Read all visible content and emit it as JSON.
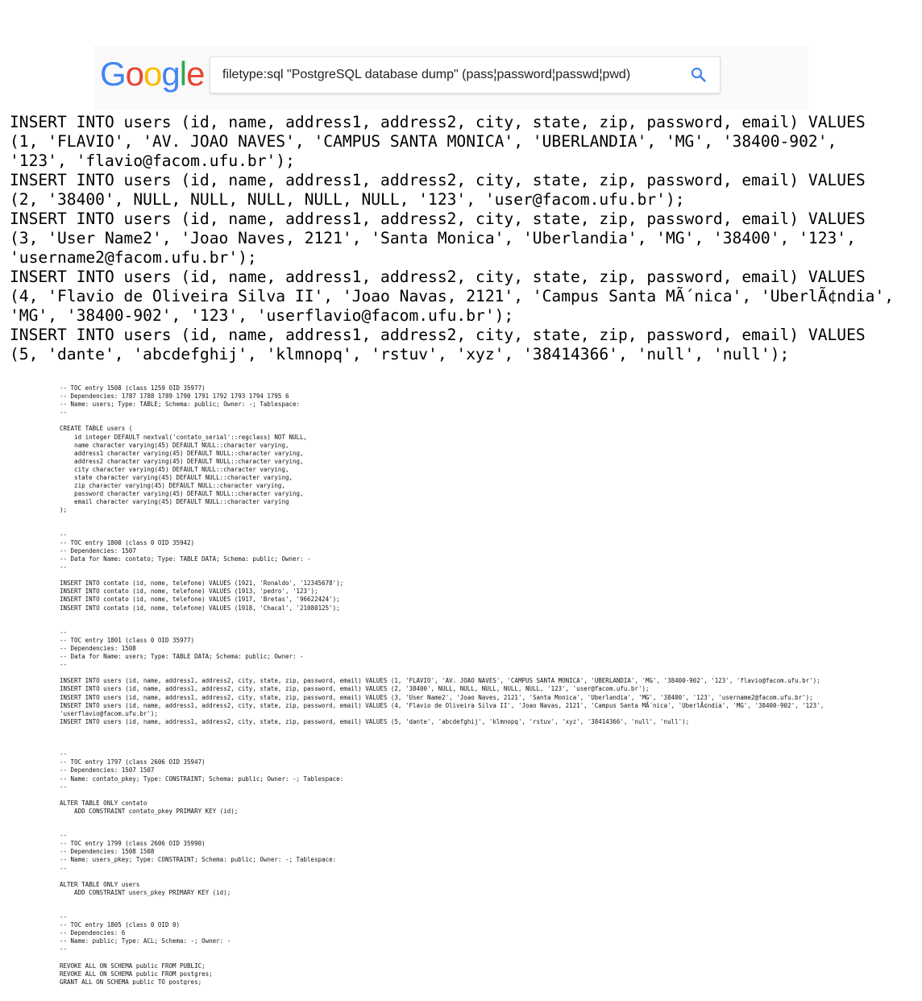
{
  "search": {
    "logo_letters": [
      "G",
      "o",
      "o",
      "g",
      "l",
      "e"
    ],
    "logo_colors": [
      "#4285F4",
      "#EA4335",
      "#FBBC05",
      "#4285F4",
      "#34A853",
      "#EA4335"
    ],
    "query": "filetype:sql \"PostgreSQL database dump\" (pass¦password¦passwd¦pwd)",
    "button_icon": "search-icon",
    "accent": "#4285F4"
  },
  "zoomed_sql": [
    "INSERT INTO users (id, name, address1, address2, city, state, zip, password, email) VALUES",
    "(1, 'FLAVIO', 'AV. JOAO NAVES', 'CAMPUS SANTA MONICA', 'UBERLANDIA', 'MG', '38400-902',",
    "'123', 'flavio@facom.ufu.br');",
    "INSERT INTO users (id, name, address1, address2, city, state, zip, password, email) VALUES",
    "(2, '38400', NULL, NULL, NULL, NULL, NULL, '123', 'user@facom.ufu.br');",
    "INSERT INTO users (id, name, address1, address2, city, state, zip, password, email) VALUES",
    "(3, 'User Name2', 'Joao Naves, 2121', 'Santa Monica', 'Uberlandia', 'MG', '38400', '123',",
    "'username2@facom.ufu.br');",
    "INSERT INTO users (id, name, address1, address2, city, state, zip, password, email) VALUES",
    "(4, 'Flavio de Oliveira Silva II', 'Joao Navas, 2121', 'Campus Santa MÃ´nica', 'UberlÃ¢ndia',",
    "'MG', '38400-902', '123', 'userflavio@facom.ufu.br');",
    "INSERT INTO users (id, name, address1, address2, city, state, zip, password, email) VALUES",
    "(5, 'dante', 'abcdefghij', 'klmnopq', 'rstuv', 'xyz', '38414366', 'null', 'null');"
  ],
  "dump_lines": [
    "-- TOC entry 1508 (class 1259 OID 35977)",
    "-- Dependencies: 1787 1788 1789 1790 1791 1792 1793 1794 1795 6",
    "-- Name: users; Type: TABLE; Schema: public; Owner: -; Tablespace:",
    "--",
    "",
    "CREATE TABLE users (",
    "    id integer DEFAULT nextval('contato_serial'::regclass) NOT NULL,",
    "    name character varying(45) DEFAULT NULL::character varying,",
    "    address1 character varying(45) DEFAULT NULL::character varying,",
    "    address2 character varying(45) DEFAULT NULL::character varying,",
    "    city character varying(45) DEFAULT NULL::character varying,",
    "    state character varying(45) DEFAULT NULL::character varying,",
    "    zip character varying(45) DEFAULT NULL::character varying,",
    "    password character varying(45) DEFAULT NULL::character varying,",
    "    email character varying(45) DEFAULT NULL::character varying",
    ");",
    "",
    "",
    "--",
    "-- TOC entry 1800 (class 0 OID 35942)",
    "-- Dependencies: 1507",
    "-- Data for Name: contato; Type: TABLE DATA; Schema: public; Owner: -",
    "--",
    "",
    "INSERT INTO contato (id, nome, telefone) VALUES (1921, 'Ronaldo', '12345678');",
    "INSERT INTO contato (id, nome, telefone) VALUES (1913, 'pedro', '123');",
    "INSERT INTO contato (id, nome, telefone) VALUES (1917, 'Bretas', '96622424');",
    "INSERT INTO contato (id, nome, telefone) VALUES (1918, 'Chacal', '21080125');",
    "",
    "",
    "--",
    "-- TOC entry 1801 (class 0 OID 35977)",
    "-- Dependencies: 1508",
    "-- Data for Name: users; Type: TABLE DATA; Schema: public; Owner: -",
    "--",
    "",
    "INSERT INTO users (id, name, address1, address2, city, state, zip, password, email) VALUES (1, 'FLAVIO', 'AV. JOAO NAVES', 'CAMPUS SANTA MONICA', 'UBERLANDIA', 'MG', '38400-902', '123', 'flavio@facom.ufu.br');",
    "INSERT INTO users (id, name, address1, address2, city, state, zip, password, email) VALUES (2, '38400', NULL, NULL, NULL, NULL, NULL, '123', 'user@facom.ufu.br');",
    "INSERT INTO users (id, name, address1, address2, city, state, zip, password, email) VALUES (3, 'User Name2', 'Joao Naves, 2121', 'Santa Monica', 'Uberlandia', 'MG', '38400', '123', 'username2@facom.ufu.br');",
    "INSERT INTO users (id, name, address1, address2, city, state, zip, password, email) VALUES (4, 'Flavio de Oliveira Silva II', 'Joao Navas, 2121', 'Campus Santa MÃ´nica', 'UberlÃ¢ndia', 'MG', '38400-902', '123',",
    "'userflavio@facom.ufu.br');",
    "INSERT INTO users (id, name, address1, address2, city, state, zip, password, email) VALUES (5, 'dante', 'abcdefghij', 'klmnopq', 'rstuv', 'xyz', '38414366', 'null', 'null');",
    "",
    "",
    "",
    "--",
    "-- TOC entry 1797 (class 2606 OID 35947)",
    "-- Dependencies: 1507 1507",
    "-- Name: contato_pkey; Type: CONSTRAINT; Schema: public; Owner: -; Tablespace:",
    "--",
    "",
    "ALTER TABLE ONLY contato",
    "    ADD CONSTRAINT contato_pkey PRIMARY KEY (id);",
    "",
    "",
    "--",
    "-- TOC entry 1799 (class 2606 OID 35990)",
    "-- Dependencies: 1508 1508",
    "-- Name: users_pkey; Type: CONSTRAINT; Schema: public; Owner: -; Tablespace:",
    "--",
    "",
    "ALTER TABLE ONLY users",
    "    ADD CONSTRAINT users_pkey PRIMARY KEY (id);",
    "",
    "",
    "--",
    "-- TOC entry 1805 (class 0 OID 0)",
    "-- Dependencies: 6",
    "-- Name: public; Type: ACL; Schema: -; Owner: -",
    "--",
    "",
    "REVOKE ALL ON SCHEMA public FROM PUBLIC;",
    "REVOKE ALL ON SCHEMA public FROM postgres;",
    "GRANT ALL ON SCHEMA public TO postgres;"
  ]
}
